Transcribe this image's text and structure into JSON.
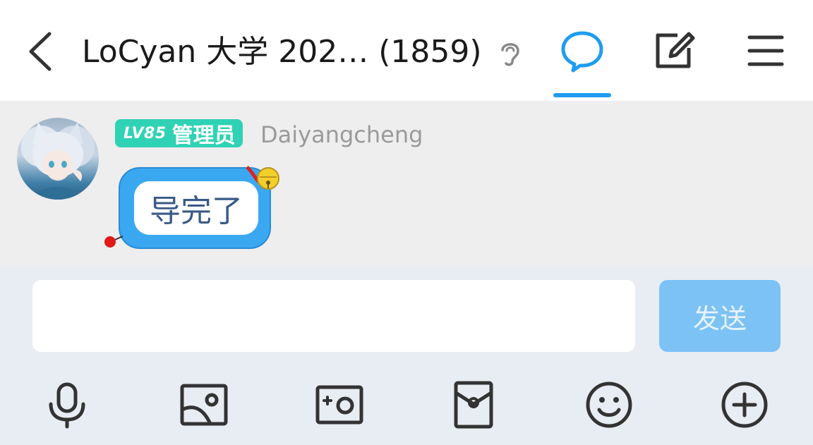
{
  "header": {
    "title": "LoCyan 大学 202…  (1859)",
    "icons": [
      "back-icon",
      "ear-icon",
      "chat-bubble-icon",
      "edit-icon",
      "menu-icon"
    ],
    "active_tab_color": "#1f9cf0"
  },
  "message": {
    "level_badge": "LV85",
    "role_badge": "管理员",
    "sender": "Daiyangcheng",
    "text": "导完了",
    "badge_color": "#2fd2b4",
    "bubble_color": "#3aa8f1"
  },
  "composer": {
    "input_value": "",
    "send_label": "发送",
    "send_color": "#7cc2f5"
  },
  "toolbar": {
    "icons": [
      "microphone-icon",
      "image-icon",
      "camera-icon",
      "red-envelope-icon",
      "emoji-icon",
      "plus-icon"
    ]
  }
}
